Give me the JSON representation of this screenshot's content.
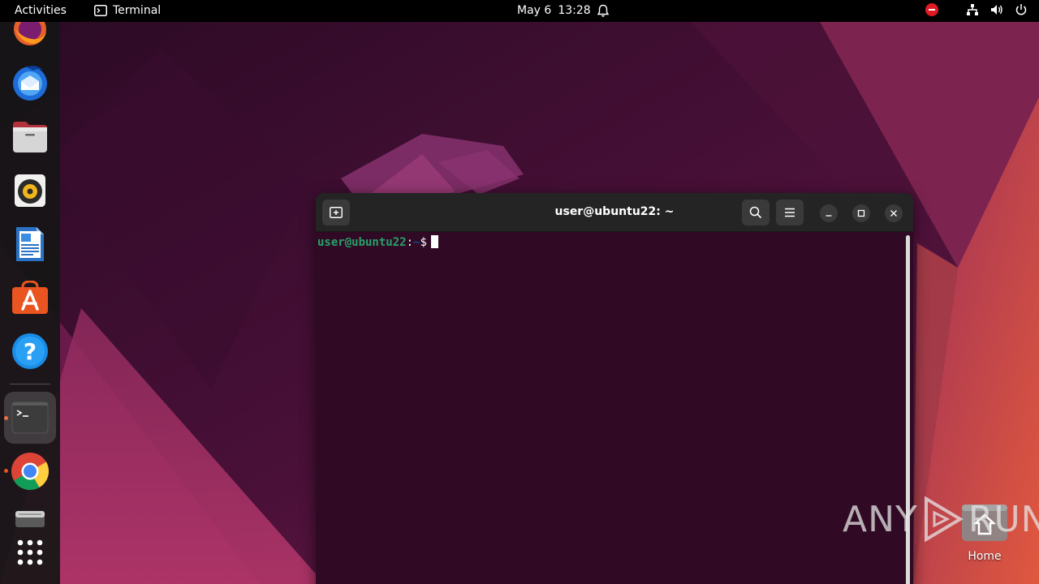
{
  "topbar": {
    "activities_label": "Activities",
    "app_label": "Terminal",
    "date": "May 6",
    "time": "13:28"
  },
  "dock": {
    "items": [
      {
        "name": "firefox",
        "running": false
      },
      {
        "name": "thunderbird",
        "running": false
      },
      {
        "name": "files",
        "running": false
      },
      {
        "name": "rhythmbox",
        "running": false
      },
      {
        "name": "libreoffice-writer",
        "running": false
      },
      {
        "name": "ubuntu-software",
        "running": false
      },
      {
        "name": "help",
        "running": false
      },
      {
        "name": "terminal",
        "running": true
      },
      {
        "name": "chrome",
        "running": true
      },
      {
        "name": "disk-drive",
        "running": false
      },
      {
        "name": "show-applications",
        "running": false
      }
    ]
  },
  "terminal": {
    "title": "user@ubuntu22: ~",
    "prompt_user": "user@ubuntu22",
    "prompt_sep": ":",
    "prompt_path": "~",
    "prompt_symbol": "$"
  },
  "desktop": {
    "home_label": "Home"
  },
  "watermark": {
    "left": "ANY",
    "right": "RUN"
  },
  "colors": {
    "accent": "#e95420",
    "terminal_bg": "#300a24",
    "prompt_user": "#26a269",
    "prompt_path": "#12488b"
  }
}
